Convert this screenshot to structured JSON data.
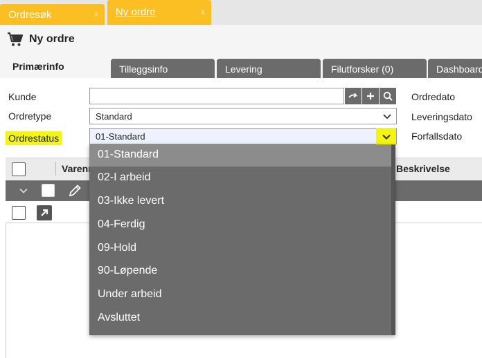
{
  "tabs": {
    "doc_tabs": [
      {
        "label": "Ordresøk",
        "close": "x"
      },
      {
        "label": "Ny ordre",
        "close": "x"
      }
    ]
  },
  "page": {
    "title": "Ny ordre"
  },
  "section_tabs": [
    "Primærinfo",
    "Tilleggsinfo",
    "Levering",
    "Filutforsker (0)",
    "Dashboard"
  ],
  "form": {
    "kunde_label": "Kunde",
    "kunde_value": "",
    "ordretype_label": "Ordretype",
    "ordretype_value": "Standard",
    "ordrestatus_label": "Ordrestatus",
    "ordrestatus_value": "01-Standard",
    "ordredato_label": "Ordredato",
    "leveringsdato_label": "Leveringsdato",
    "forfallsdato_label": "Forfallsdato"
  },
  "grid": {
    "columns": [
      "Varenr",
      "Beskrivelse"
    ]
  },
  "dropdown": {
    "options": [
      "01-Standard",
      "02-I arbeid",
      "03-Ikke levert",
      "04-Ferdig",
      "09-Hold",
      "90-Løpende",
      "Under arbeid",
      "Avsluttet"
    ],
    "selected_index": 0
  },
  "colors": {
    "accent": "#fbbf24",
    "highlight": "#f5f515",
    "tab_gray": "#6b6b6b"
  }
}
